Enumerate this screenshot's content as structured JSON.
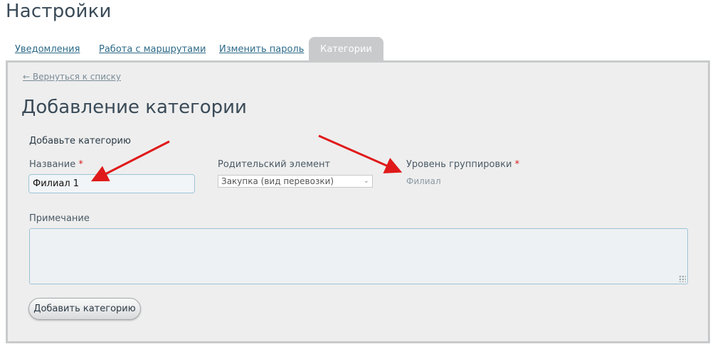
{
  "page": {
    "title": "Настройки"
  },
  "tabs": [
    {
      "label": "Уведомления",
      "active": false
    },
    {
      "label": "Работа с маршрутами",
      "active": false
    },
    {
      "label": "Изменить пароль",
      "active": false
    },
    {
      "label": "Категории",
      "active": true
    }
  ],
  "form": {
    "back_link": "← Вернуться к списку",
    "title": "Добавление категории",
    "section_label": "Добавьте категорию",
    "name": {
      "label": "Название",
      "required_mark": "*",
      "value": "Филиал 1"
    },
    "parent": {
      "label": "Родительский элемент",
      "selected": "Закупка (вид перевозки)"
    },
    "grouping": {
      "label": "Уровень группировки",
      "required_mark": "*",
      "value": "Филиал"
    },
    "note": {
      "label": "Примечание",
      "value": ""
    },
    "submit_label": "Добавить категорию"
  },
  "annotations": {
    "arrow_color": "#e01a1a"
  },
  "colors": {
    "active_tab": "#c9cacb",
    "panel_bg": "#eeeeee",
    "link": "#2c6a88",
    "required": "#d42020"
  }
}
